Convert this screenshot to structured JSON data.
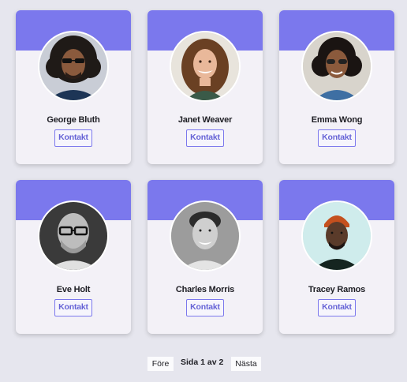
{
  "colors": {
    "background": "#e6e6ee",
    "card": "#f3f1f7",
    "accent": "#7b78ed",
    "button_text": "#6663d6"
  },
  "people": [
    {
      "name": "George Bluth",
      "button": "Kontakt",
      "avatar": "person-photo-icon"
    },
    {
      "name": "Janet Weaver",
      "button": "Kontakt",
      "avatar": "person-photo-icon"
    },
    {
      "name": "Emma Wong",
      "button": "Kontakt",
      "avatar": "person-photo-icon"
    },
    {
      "name": "Eve Holt",
      "button": "Kontakt",
      "avatar": "person-photo-icon"
    },
    {
      "name": "Charles Morris",
      "button": "Kontakt",
      "avatar": "person-photo-icon"
    },
    {
      "name": "Tracey Ramos",
      "button": "Kontakt",
      "avatar": "person-photo-icon"
    }
  ],
  "pagination": {
    "prev_label": "Före",
    "info": "Sida 1 av 2",
    "next_label": "Nästa"
  }
}
